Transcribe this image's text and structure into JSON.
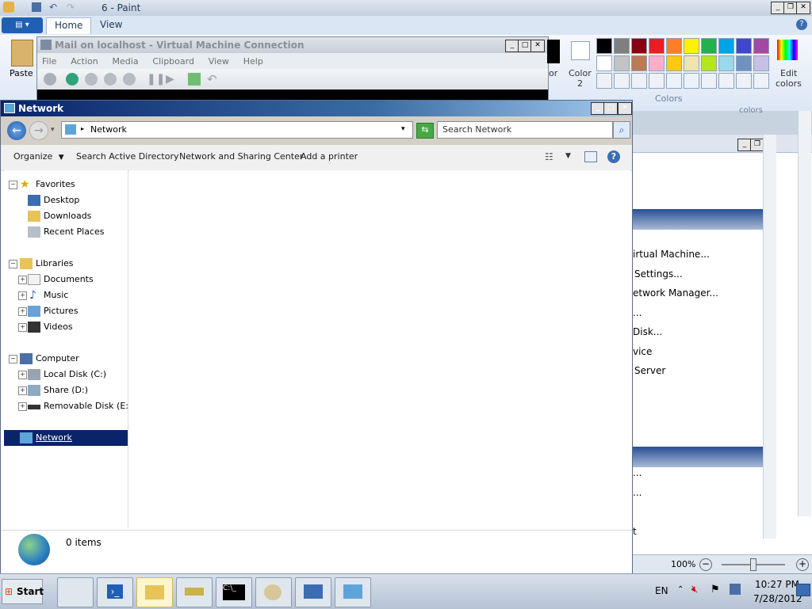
{
  "paint": {
    "title": "6 - Paint",
    "tabs": [
      "Home",
      "View"
    ],
    "paste_label": "Paste",
    "color_partial": "or",
    "color2_label": "Color",
    "color2_num": "2",
    "edit_colors_line1": "Edit",
    "edit_colors_line2": "colors",
    "colors_group_label": "Colors",
    "colors_partial": "colors",
    "zoom": "100%",
    "palette_row1": [
      "#000000",
      "#7f7f7f",
      "#880015",
      "#ed1c24",
      "#ff7f27",
      "#fff200",
      "#22b14c",
      "#00a2e8",
      "#3f48cc",
      "#a349a4"
    ],
    "palette_row2": [
      "#ffffff",
      "#c3c3c3",
      "#b97a57",
      "#ffaec9",
      "#ffc90e",
      "#efe4b0",
      "#b5e61d",
      "#99d9ea",
      "#7092be",
      "#c8bfe7"
    ]
  },
  "underlying_panel": {
    "rows": [
      "irtual Machine...",
      "Settings...",
      "etwork Manager...",
      "...",
      "Disk...",
      "vice",
      "Server",
      "",
      "",
      "...",
      "...",
      "",
      "t"
    ]
  },
  "vm": {
    "title": "Mail on localhost - Virtual Machine Connection",
    "menu": [
      "File",
      "Action",
      "Media",
      "Clipboard",
      "View",
      "Help"
    ]
  },
  "explorer": {
    "title": "Network",
    "address": "Network",
    "search_placeholder": "Search Network",
    "commands": [
      "Organize",
      "Search Active Directory",
      "Network and Sharing Center",
      "Add a printer"
    ],
    "nav": {
      "favorites": "Favorites",
      "desktop": "Desktop",
      "downloads": "Downloads",
      "recent": "Recent Places",
      "libraries": "Libraries",
      "documents": "Documents",
      "music": "Music",
      "pictures": "Pictures",
      "videos": "Videos",
      "computer": "Computer",
      "local_disk": "Local Disk (C:)",
      "share": "Share (D:)",
      "removable": "Removable Disk (E:)",
      "network": "Network"
    },
    "status": "0 items"
  },
  "taskbar": {
    "start": "Start",
    "lang": "EN",
    "time": "10:27 PM",
    "date": "7/28/2012"
  }
}
